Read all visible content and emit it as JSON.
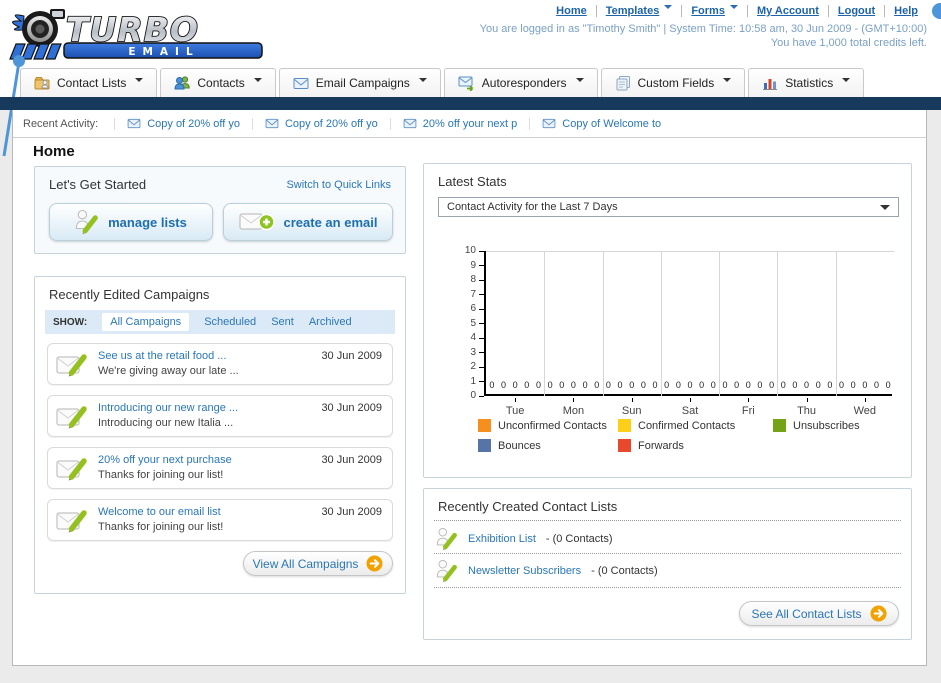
{
  "header": {
    "logo_title": "TURBO",
    "logo_subtitle": "EMAIL",
    "nav_links": [
      "Home",
      "Templates",
      "Forms",
      "My Account",
      "Logout",
      "Help"
    ],
    "login_info": "You are logged in as \"Timothy Smith\" | System Time: 10:58 am, 30 Jun 2009 - (GMT+10:00)",
    "credits_info": "You have 1,000 total credits left."
  },
  "tabs": [
    {
      "label": "Contact Lists"
    },
    {
      "label": "Contacts"
    },
    {
      "label": "Email Campaigns"
    },
    {
      "label": "Autoresponders"
    },
    {
      "label": "Custom Fields"
    },
    {
      "label": "Statistics"
    }
  ],
  "recent_activity": {
    "label": "Recent Activity:",
    "items": [
      "Copy of 20% off yo",
      "Copy of 20% off yo",
      "20% off your next p",
      "Copy of Welcome to"
    ]
  },
  "page_title": "Home",
  "get_started": {
    "title": "Let's Get Started",
    "switch_link": "Switch to Quick Links",
    "manage_lists_label": "manage lists",
    "create_email_label": "create an email"
  },
  "campaigns": {
    "title": "Recently Edited Campaigns",
    "show_label": "SHOW:",
    "filters": [
      "All Campaigns",
      "Scheduled",
      "Sent",
      "Archived"
    ],
    "active_filter": "All Campaigns",
    "items": [
      {
        "title": "See us at the retail food ...",
        "subtitle": "We're giving away our late ...",
        "date": "30 Jun 2009"
      },
      {
        "title": "Introducing our new range ...",
        "subtitle": "Introducing our new Italia ...",
        "date": "30 Jun 2009"
      },
      {
        "title": "20% off your next purchase",
        "subtitle": "Thanks for joining our list!",
        "date": "30 Jun 2009"
      },
      {
        "title": "Welcome to our email list",
        "subtitle": "Thanks for joining our list!",
        "date": "30 Jun 2009"
      }
    ],
    "view_all_label": "View All Campaigns"
  },
  "latest_stats": {
    "title": "Latest Stats",
    "dropdown_value": "Contact Activity for the Last 7 Days"
  },
  "chart_data": {
    "type": "bar",
    "title": "Contact Activity for the Last 7 Days",
    "categories": [
      "Tue",
      "Mon",
      "Sun",
      "Sat",
      "Fri",
      "Thu",
      "Wed"
    ],
    "series": [
      {
        "name": "Unconfirmed Contacts",
        "color": "#f78f1e",
        "values": [
          0,
          0,
          0,
          0,
          0,
          0,
          0
        ]
      },
      {
        "name": "Confirmed Contacts",
        "color": "#fdd017",
        "values": [
          0,
          0,
          0,
          0,
          0,
          0,
          0
        ]
      },
      {
        "name": "Unsubscribes",
        "color": "#74a318",
        "values": [
          0,
          0,
          0,
          0,
          0,
          0,
          0
        ]
      },
      {
        "name": "Bounces",
        "color": "#5674a8",
        "values": [
          0,
          0,
          0,
          0,
          0,
          0,
          0
        ]
      },
      {
        "name": "Forwards",
        "color": "#e8492e",
        "values": [
          0,
          0,
          0,
          0,
          0,
          0,
          0
        ]
      }
    ],
    "ylim": [
      0,
      10
    ],
    "yticks": [
      0,
      1,
      2,
      3,
      4,
      5,
      6,
      7,
      8,
      9,
      10
    ],
    "grid": "vertical",
    "legend_position": "bottom",
    "xlabel": "",
    "ylabel": ""
  },
  "contact_lists": {
    "title": "Recently Created Contact Lists",
    "items": [
      {
        "name": "Exhibition List",
        "detail": "- (0 Contacts)"
      },
      {
        "name": "Newsletter Subscribers",
        "detail": "- (0 Contacts)"
      }
    ],
    "see_all_label": "See All Contact Lists"
  }
}
